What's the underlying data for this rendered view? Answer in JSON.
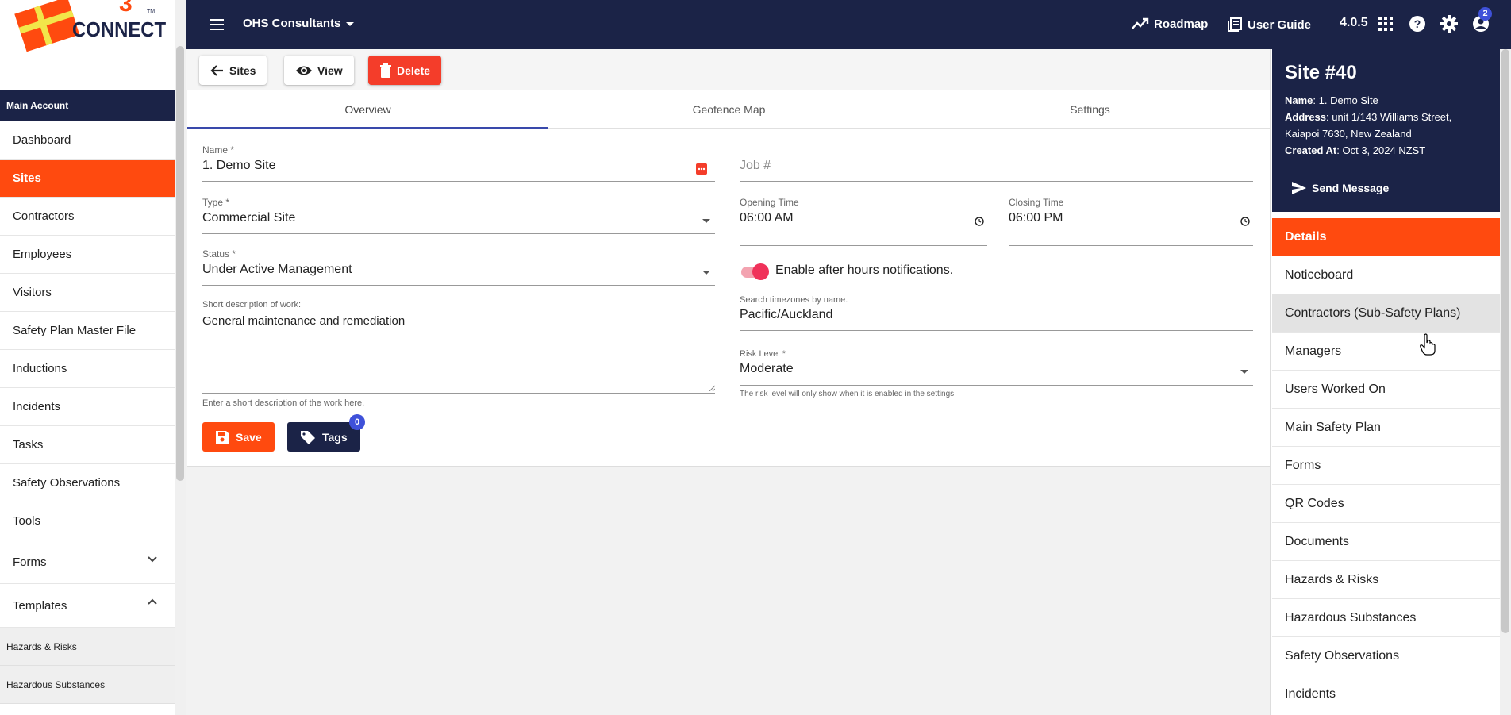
{
  "logo": {
    "text": "CONNECT",
    "mark": "TM"
  },
  "sidebar": {
    "section": "Main Account",
    "items": [
      {
        "label": "Dashboard"
      },
      {
        "label": "Sites"
      },
      {
        "label": "Contractors"
      },
      {
        "label": "Employees"
      },
      {
        "label": "Visitors"
      },
      {
        "label": "Safety Plan Master File"
      },
      {
        "label": "Inductions"
      },
      {
        "label": "Incidents"
      },
      {
        "label": "Tasks"
      },
      {
        "label": "Safety Observations"
      },
      {
        "label": "Tools"
      },
      {
        "label": "Forms"
      },
      {
        "label": "Templates"
      }
    ],
    "sub_items": [
      {
        "label": "Hazards & Risks"
      },
      {
        "label": "Hazardous Substances"
      }
    ]
  },
  "topbar": {
    "org": "OHS Consultants",
    "roadmap": "Roadmap",
    "user_guide": "User Guide",
    "version": "4.0.5",
    "notifications": "2"
  },
  "toolbar": {
    "back_label": "Sites",
    "view_label": "View",
    "delete_label": "Delete"
  },
  "tabs": [
    {
      "label": "Overview"
    },
    {
      "label": "Geofence Map"
    },
    {
      "label": "Settings"
    }
  ],
  "form": {
    "name_label": "Name *",
    "name_value": "1. Demo Site",
    "job_placeholder": "Job #",
    "type_label": "Type *",
    "type_value": "Commercial Site",
    "opening_label": "Opening Time",
    "opening_value": "06:00 AM",
    "closing_label": "Closing Time",
    "closing_value": "06:00 PM",
    "status_label": "Status *",
    "status_value": "Under Active Management",
    "toggle_label": "Enable after hours notifications.",
    "toggle_on": true,
    "desc_label": "Short description of work:",
    "desc_value": "General maintenance and remediation",
    "desc_hint": "Enter a short description of the work here.",
    "tz_label": "Search timezones by name.",
    "tz_value": "Pacific/Auckland",
    "risk_label": "Risk Level *",
    "risk_value": "Moderate",
    "risk_hint": "The risk level will only show when it is enabled in the settings.",
    "save_label": "Save",
    "tags_label": "Tags",
    "tags_count": "0"
  },
  "site_panel": {
    "title": "Site #40",
    "name_key": "Name",
    "name_val": ": 1. Demo Site",
    "address_key": "Address",
    "address_val": ": unit 1/143 Williams Street,",
    "address_val2": "Kaiapoi 7630, New Zealand",
    "created_key": "Created At",
    "created_val": ": Oct 3, 2024 NZST",
    "send_label": "Send Message",
    "details_label": "Details",
    "items": [
      {
        "label": "Noticeboard"
      },
      {
        "label": "Contractors (Sub-Safety Plans)"
      },
      {
        "label": "Managers"
      },
      {
        "label": "Users Worked On"
      },
      {
        "label": "Main Safety Plan"
      },
      {
        "label": "Forms"
      },
      {
        "label": "QR Codes"
      },
      {
        "label": "Documents"
      },
      {
        "label": "Hazards & Risks"
      },
      {
        "label": "Hazardous Substances"
      },
      {
        "label": "Safety Observations"
      },
      {
        "label": "Incidents"
      }
    ]
  },
  "colors": {
    "navy": "#1b2347",
    "orange": "#ff4a0f",
    "red": "#f43d2a",
    "accent": "#3f51d9"
  }
}
